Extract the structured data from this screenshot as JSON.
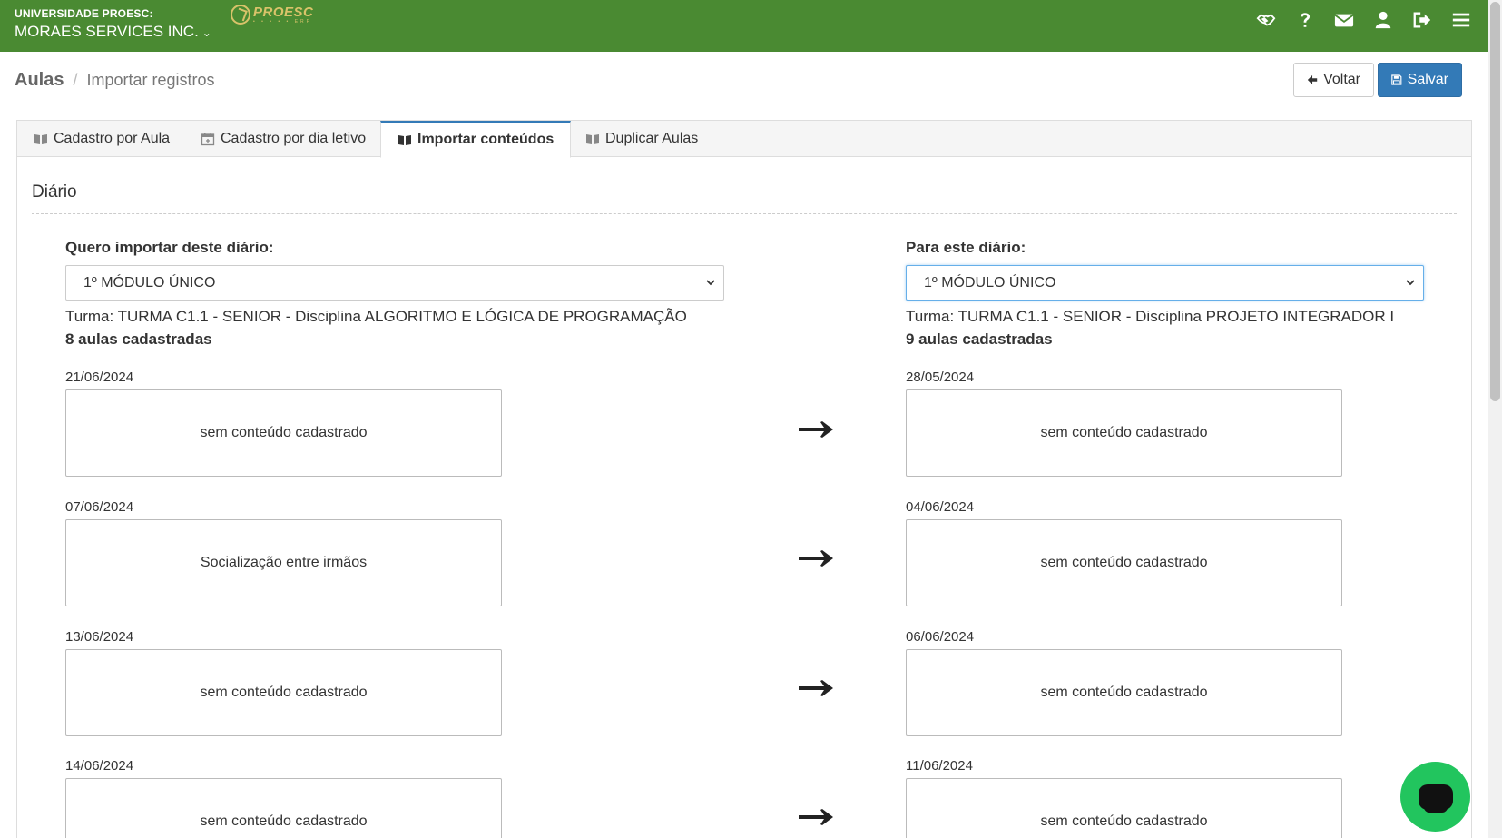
{
  "topbar": {
    "org_small": "UNIVERSIDADE PROESC:",
    "org_name": "MORAES SERVICES INC.",
    "logo_text": "PROESC",
    "logo_sub": "• • • • • ERP",
    "icons": [
      "handshake-icon",
      "help-icon",
      "mail-icon",
      "user-icon",
      "logout-icon",
      "menu-icon"
    ],
    "bg_color": "#4a8a32"
  },
  "header": {
    "title": "Aulas",
    "separator": "/",
    "subtitle": "Importar registros",
    "back_label": "Voltar",
    "save_label": "Salvar"
  },
  "tabs": [
    {
      "label": "Cadastro por Aula",
      "icon": "book-icon",
      "active": false
    },
    {
      "label": "Cadastro por dia letivo",
      "icon": "calendar-icon",
      "active": false
    },
    {
      "label": "Importar conteúdos",
      "icon": "book-icon",
      "active": true
    },
    {
      "label": "Duplicar Aulas",
      "icon": "book-icon",
      "active": false
    }
  ],
  "section": {
    "title": "Diário"
  },
  "source": {
    "label": "Quero importar deste diário:",
    "selected": "1º MÓDULO ÚNICO",
    "turma": "Turma: TURMA C1.1 - SENIOR - Disciplina ALGORITMO E LÓGICA DE PROGRAMAÇÃO",
    "count": "8 aulas cadastradas",
    "items": [
      {
        "date": "21/06/2024",
        "content": "sem conteúdo cadastrado"
      },
      {
        "date": "07/06/2024",
        "content": "Socialização entre irmãos"
      },
      {
        "date": "13/06/2024",
        "content": "sem conteúdo cadastrado"
      },
      {
        "date": "14/06/2024",
        "content": "sem conteúdo cadastrado"
      }
    ]
  },
  "target": {
    "label": "Para este diário:",
    "selected": "1º MÓDULO ÚNICO",
    "turma": "Turma: TURMA C1.1 - SENIOR - Disciplina PROJETO INTEGRADOR I",
    "count": "9 aulas cadastradas",
    "items": [
      {
        "date": "28/05/2024",
        "content": "sem conteúdo cadastrado"
      },
      {
        "date": "04/06/2024",
        "content": "sem conteúdo cadastrado"
      },
      {
        "date": "06/06/2024",
        "content": "sem conteúdo cadastrado"
      },
      {
        "date": "11/06/2024",
        "content": "sem conteúdo cadastrado"
      }
    ]
  },
  "colors": {
    "primary": "#337ab7",
    "chat": "#22c55e"
  }
}
